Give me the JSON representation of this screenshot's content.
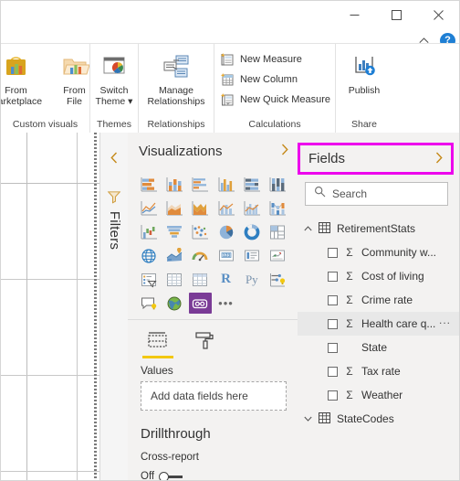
{
  "window": {
    "minimize_label": "Minimize",
    "maximize_label": "Maximize",
    "close_label": "Close",
    "collapse_ribbon_label": "Collapse the Ribbon",
    "help_label": "?"
  },
  "ribbon": {
    "groups": [
      {
        "title": "Custom visuals",
        "buttons": [
          {
            "label_line1": "From",
            "label_line2": "Marketplace",
            "icon": "marketplace-icon"
          },
          {
            "label_line1": "From",
            "label_line2": "File",
            "icon": "folder-chart-icon"
          }
        ]
      },
      {
        "title": "Themes",
        "buttons": [
          {
            "label_line1": "Switch",
            "label_line2": "Theme",
            "icon": "switch-theme-icon",
            "has_dropdown": true
          }
        ]
      },
      {
        "title": "Relationships",
        "buttons": [
          {
            "label_line1": "Manage",
            "label_line2": "Relationships",
            "icon": "manage-relationships-icon"
          }
        ]
      },
      {
        "title": "Calculations",
        "items": [
          {
            "label": "New Measure",
            "icon": "new-measure-icon"
          },
          {
            "label": "New Column",
            "icon": "new-column-icon"
          },
          {
            "label": "New Quick Measure",
            "icon": "new-quick-measure-icon"
          }
        ]
      },
      {
        "title": "Share",
        "buttons": [
          {
            "label_line1": "Publish",
            "label_line2": "",
            "icon": "publish-icon"
          }
        ]
      }
    ]
  },
  "filters_pane": {
    "title": "Filters",
    "expand_label": "<",
    "icon": "filter-funnel-icon"
  },
  "visualizations": {
    "title": "Visualizations",
    "expand_label": ">",
    "icons": [
      "stacked-bar-chart-icon",
      "stacked-column-chart-icon",
      "clustered-bar-chart-icon",
      "clustered-column-chart-icon",
      "hundred-percent-stacked-bar-chart-icon",
      "hundred-percent-stacked-column-chart-icon",
      "line-chart-icon",
      "area-chart-icon",
      "stacked-area-chart-icon",
      "line-and-stacked-column-chart-icon",
      "line-and-clustered-column-chart-icon",
      "ribbon-chart-icon",
      "waterfall-chart-icon",
      "funnel-icon",
      "scatter-chart-icon",
      "pie-chart-icon",
      "donut-chart-icon",
      "treemap-icon",
      "map-icon",
      "filled-map-icon",
      "gauge-icon",
      "card-icon",
      "multi-row-card-icon",
      "kpi-icon",
      "slicer-icon",
      "table-icon",
      "matrix-icon",
      "r-script-visual-icon",
      "python-visual-icon",
      "key-influencers-icon",
      "q-and-a-icon",
      "arcgis-maps-icon",
      "custom-visual-selected-icon",
      "more-options-icon"
    ],
    "selected_icon_index": 32,
    "tabs": [
      {
        "name": "fields-tab",
        "icon": "fields-well-icon",
        "active": true
      },
      {
        "name": "format-tab",
        "icon": "paint-roller-icon",
        "active": false
      }
    ],
    "well_label": "Values",
    "well_placeholder": "Add data fields here",
    "drillthrough": {
      "title": "Drillthrough",
      "cross_report_label": "Cross-report",
      "cross_report_state": "Off"
    }
  },
  "fields": {
    "title": "Fields",
    "expand_label": ">",
    "highlight_color": "#ec00ec",
    "search": {
      "placeholder": "Search",
      "value": "",
      "icon": "search-icon"
    },
    "tree": [
      {
        "name": "RetirementStats",
        "type": "table",
        "expanded": true,
        "icon": "table-icon",
        "children": [
          {
            "name": "Community w...",
            "checked": false,
            "aggregate": true,
            "hovered": false
          },
          {
            "name": "Cost of living",
            "checked": false,
            "aggregate": true,
            "hovered": false
          },
          {
            "name": "Crime rate",
            "checked": false,
            "aggregate": true,
            "hovered": false
          },
          {
            "name": "Health care q...",
            "checked": false,
            "aggregate": true,
            "hovered": true,
            "menu": "..."
          },
          {
            "name": "State",
            "checked": false,
            "aggregate": false,
            "hovered": false
          },
          {
            "name": "Tax rate",
            "checked": false,
            "aggregate": true,
            "hovered": false
          },
          {
            "name": "Weather",
            "checked": false,
            "aggregate": true,
            "hovered": false
          }
        ]
      },
      {
        "name": "StateCodes",
        "type": "table",
        "expanded": false,
        "icon": "table-icon",
        "children": []
      }
    ]
  }
}
